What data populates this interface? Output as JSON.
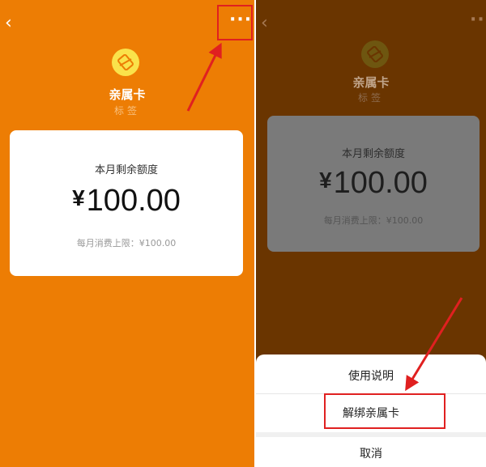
{
  "left": {
    "back_icon": "chevron-left-icon",
    "more_icon": "more-dots-icon",
    "more_symbol": "···",
    "card_logo_icon": "card-logo-icon",
    "card_name": "亲属卡",
    "card_tag": "标签",
    "balance_label": "本月剩余额度",
    "currency_symbol": "¥",
    "balance_amount": "100.00",
    "monthly_limit": "每月消费上限：¥100.00"
  },
  "right": {
    "back_icon": "chevron-left-icon",
    "more_icon": "more-dots-icon",
    "more_symbol": "···",
    "card_logo_icon": "card-logo-icon",
    "card_name": "亲属卡",
    "card_tag": "标签",
    "balance_label": "本月剩余额度",
    "currency_symbol": "¥",
    "balance_amount": "100.00",
    "monthly_limit": "每月消费上限：¥100.00",
    "sheet": {
      "usage_info_label": "使用说明",
      "unbind_label": "解绑亲属卡",
      "cancel_label": "取消"
    }
  },
  "colors": {
    "orange_bg": "#ED7D04",
    "dimmed_bg": "#6A3500",
    "logo_yellow": "#FAE24B",
    "annotation_red": "#E02020"
  }
}
